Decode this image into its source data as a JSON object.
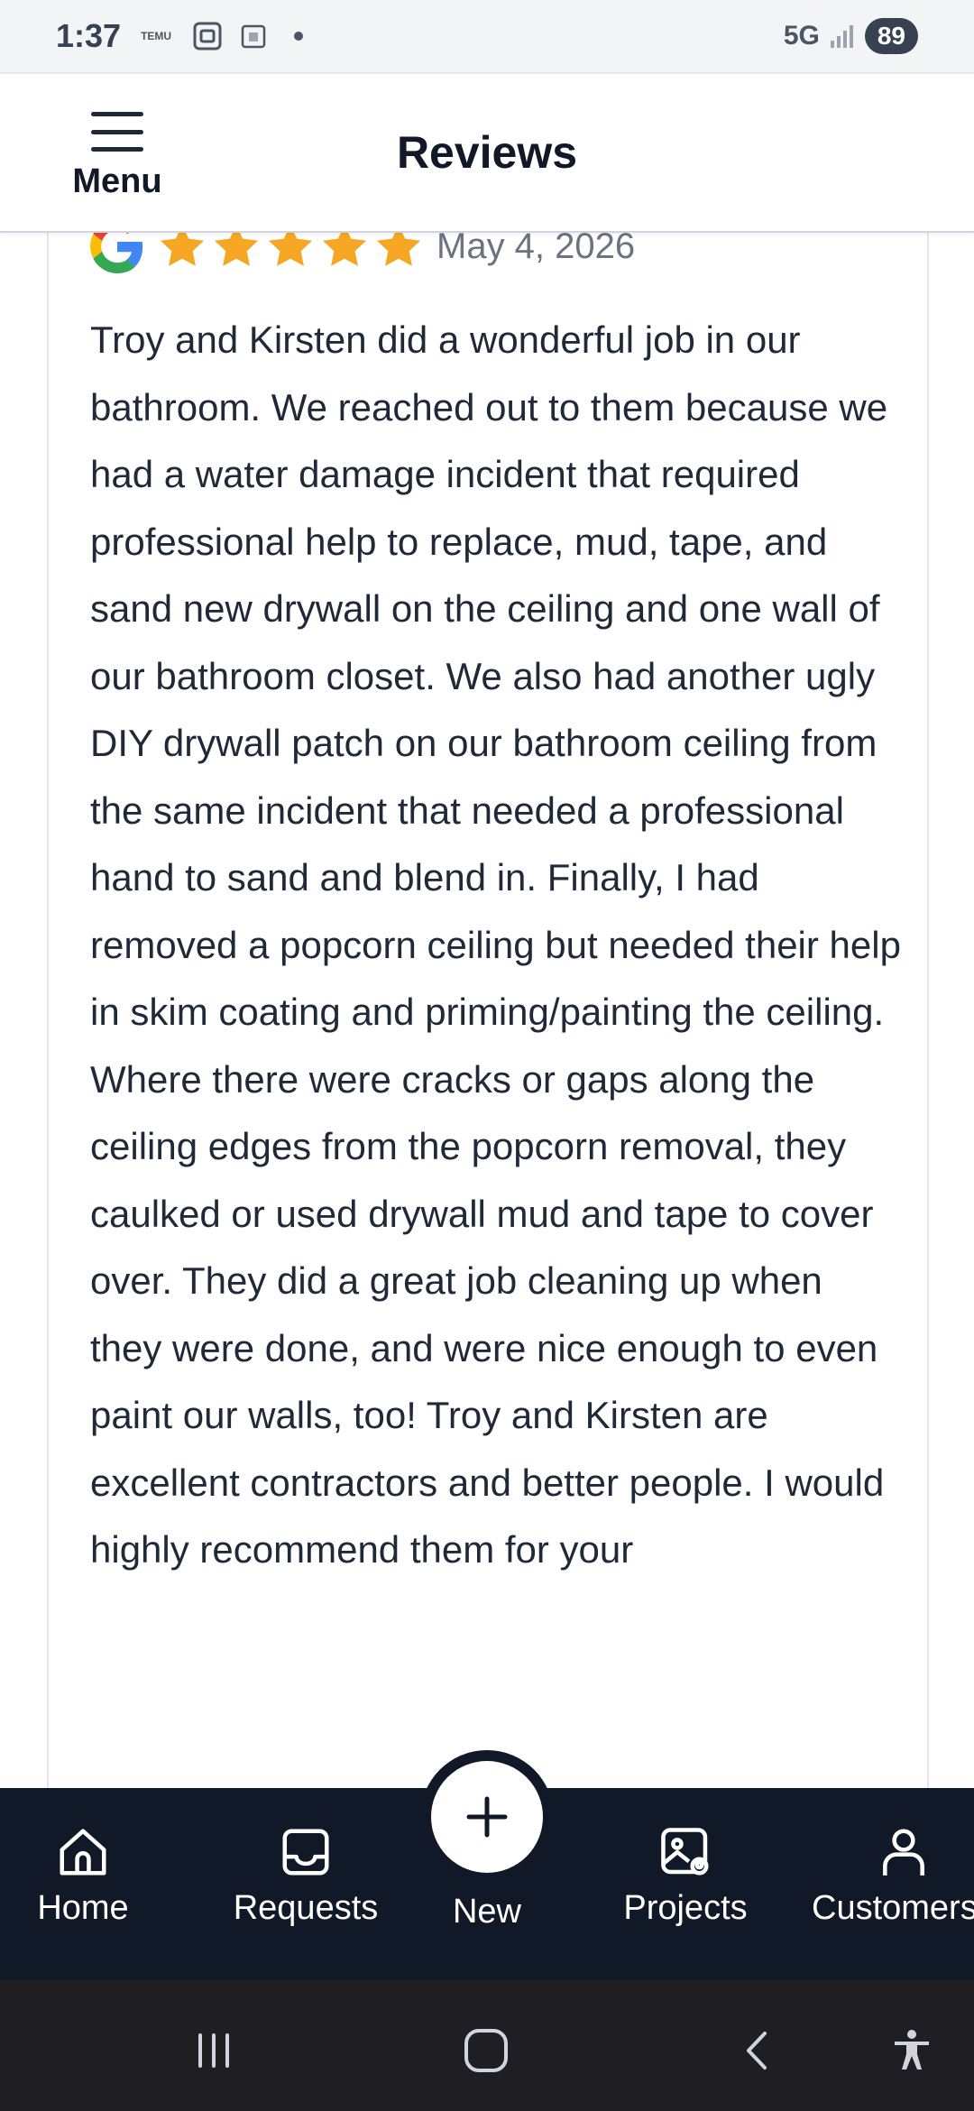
{
  "status_bar": {
    "time": "1:37",
    "temu_label": "TEMU",
    "network": "5G",
    "battery": "89"
  },
  "header": {
    "menu_label": "Menu",
    "title": "Reviews"
  },
  "review": {
    "source_icon": "google-icon",
    "rating": 5,
    "date": "May 4, 2026",
    "text": "Troy and Kirsten did a wonderful job in our bathroom. We reached out to them because we had a water damage incident that required professional help to replace, mud, tape, and sand new drywall on the ceiling and one wall of our bathroom closet. We also had another ugly DIY drywall patch on our bathroom ceiling from the same incident that needed a professional hand to sand and blend in. Finally, I had removed a popcorn ceiling but needed their help in skim coating and priming/painting the ceiling. Where there were cracks or gaps along the ceiling edges from the popcorn removal, they caulked or used drywall mud and tape to cover over. They did a great job cleaning up when they were done, and were nice enough to even paint our walls, too! Troy and Kirsten are excellent contractors and better people. I would highly recommend them for your"
  },
  "bottom_nav": {
    "items": [
      {
        "label": "Home",
        "icon": "home-icon"
      },
      {
        "label": "Requests",
        "icon": "inbox-icon"
      },
      {
        "label": "New",
        "icon": "plus-icon"
      },
      {
        "label": "Projects",
        "icon": "image-pin-icon"
      },
      {
        "label": "Customers",
        "icon": "user-icon"
      }
    ]
  },
  "colors": {
    "nav_background": "#111827",
    "star": "#f5a623",
    "system_nav": "#1f1f23"
  }
}
